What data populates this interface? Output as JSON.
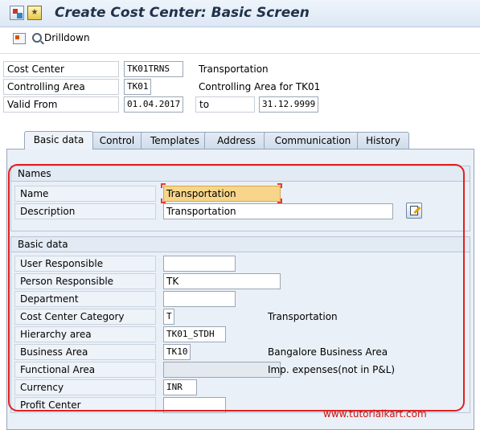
{
  "window": {
    "title": "Create Cost Center: Basic Screen"
  },
  "toolbar": {
    "drilldown_label": "Drilldown"
  },
  "header": {
    "cost_center_label": "Cost Center",
    "cost_center_value": "TK01TRNS",
    "cost_center_desc": "Transportation",
    "controlling_area_label": "Controlling Area",
    "controlling_area_value": "TK01",
    "controlling_area_desc": "Controlling Area for TK01",
    "valid_from_label": "Valid From",
    "valid_from_value": "01.04.2017",
    "to_label": "to",
    "valid_to_value": "31.12.9999"
  },
  "tabs": [
    "Basic data",
    "Control",
    "Templates",
    "Address",
    "Communication",
    "History"
  ],
  "names": {
    "heading": "Names",
    "name_label": "Name",
    "name_value": "Transportation",
    "description_label": "Description",
    "description_value": "Transportation"
  },
  "basic": {
    "heading": "Basic data",
    "user_responsible_label": "User Responsible",
    "user_responsible_value": "",
    "person_responsible_label": "Person Responsible",
    "person_responsible_value": "TK",
    "department_label": "Department",
    "department_value": "",
    "category_label": "Cost Center Category",
    "category_value": "T",
    "category_desc": "Transportation",
    "hierarchy_label": "Hierarchy area",
    "hierarchy_value": "TK01_STDH",
    "business_area_label": "Business Area",
    "business_area_value": "TK10",
    "business_area_desc": "Bangalore Business Area",
    "functional_area_label": "Functional Area",
    "functional_area_value": "",
    "functional_area_desc": "Imp. expenses(not in P&L)",
    "currency_label": "Currency",
    "currency_value": "INR",
    "profit_center_label": "Profit Center",
    "profit_center_value": ""
  },
  "watermark": "www.tutorialkart.com",
  "colors": {
    "highlight": "#e02020",
    "focus_field": "#f7d58a",
    "panel": "#eaf0f7"
  },
  "icons": [
    "sap-app-icon",
    "favorites-icon",
    "other-object-icon",
    "magnifier-icon",
    "edit-description-icon"
  ]
}
